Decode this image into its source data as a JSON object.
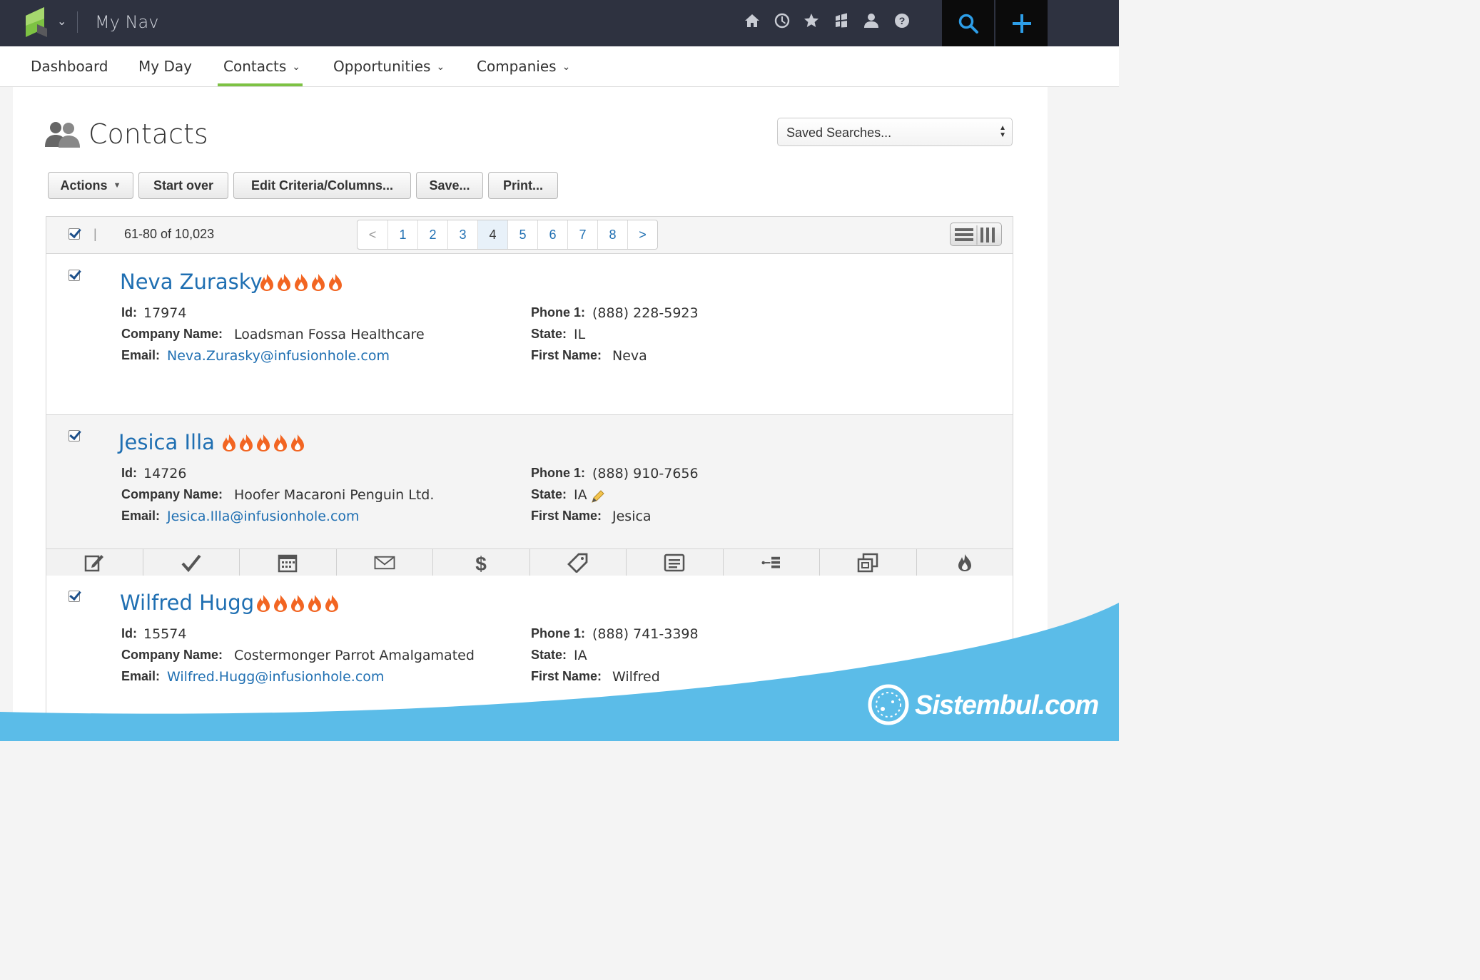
{
  "topbar": {
    "app_title": "My Nav",
    "icons": [
      "home-icon",
      "history-icon",
      "star-icon",
      "grid-icon",
      "user-icon",
      "help-icon",
      "search-icon",
      "add-icon"
    ]
  },
  "nav": {
    "items": [
      {
        "label": "Dashboard"
      },
      {
        "label": "My Day"
      },
      {
        "label": "Contacts",
        "active": true
      },
      {
        "label": "Opportunities"
      },
      {
        "label": "Companies"
      }
    ]
  },
  "page": {
    "title": "Contacts",
    "saved_searches": "Saved Searches..."
  },
  "toolbar": {
    "actions": "Actions",
    "start_over": "Start over",
    "edit_criteria": "Edit Criteria/Columns...",
    "save": "Save...",
    "print": "Print..."
  },
  "list": {
    "range": "61-80 of 10,023",
    "pager": [
      "<",
      "1",
      "2",
      "3",
      "4",
      "5",
      "6",
      "7",
      "8",
      ">"
    ],
    "current_page": "4"
  },
  "labels": {
    "id": "Id:",
    "company": "Company Name:",
    "email": "Email:",
    "phone": "Phone 1:",
    "state": "State:",
    "first_name": "First Name:"
  },
  "records": [
    {
      "name": "Neva Zurasky",
      "score": 5,
      "id": "17974",
      "company": "Loadsman Fossa Healthcare",
      "email": "Neva.Zurasky@infusionhole.com",
      "phone": "(888) 228-5923",
      "state": "IL",
      "first_name": "Neva"
    },
    {
      "name": "Jesica Illa",
      "score": 5,
      "id": "14726",
      "company": "Hoofer Macaroni Penguin Ltd.",
      "email": "Jesica.Illa@infusionhole.com",
      "phone": "(888) 910-7656",
      "state": "IA",
      "first_name": "Jesica"
    },
    {
      "name": "Wilfred Hugg",
      "score": 5,
      "id": "15574",
      "company": "Costermonger Parrot Amalgamated",
      "email": "Wilfred.Hugg@infusionhole.com",
      "phone": "(888) 741-3398",
      "state": "IA",
      "first_name": "Wilfred"
    }
  ],
  "action_icons": [
    "note-icon",
    "task-icon",
    "calendar-icon",
    "email-icon",
    "dollar-icon",
    "tag-icon",
    "document-icon",
    "sequence-icon",
    "duplicate-icon",
    "flame-icon"
  ],
  "watermark": "Sistembul.com",
  "colors": {
    "topbar": "#2e3240",
    "accent_green": "#7dc243",
    "link_blue": "#1f6fb2",
    "wave_blue": "#5bbce8",
    "flame_orange": "#f26522"
  }
}
